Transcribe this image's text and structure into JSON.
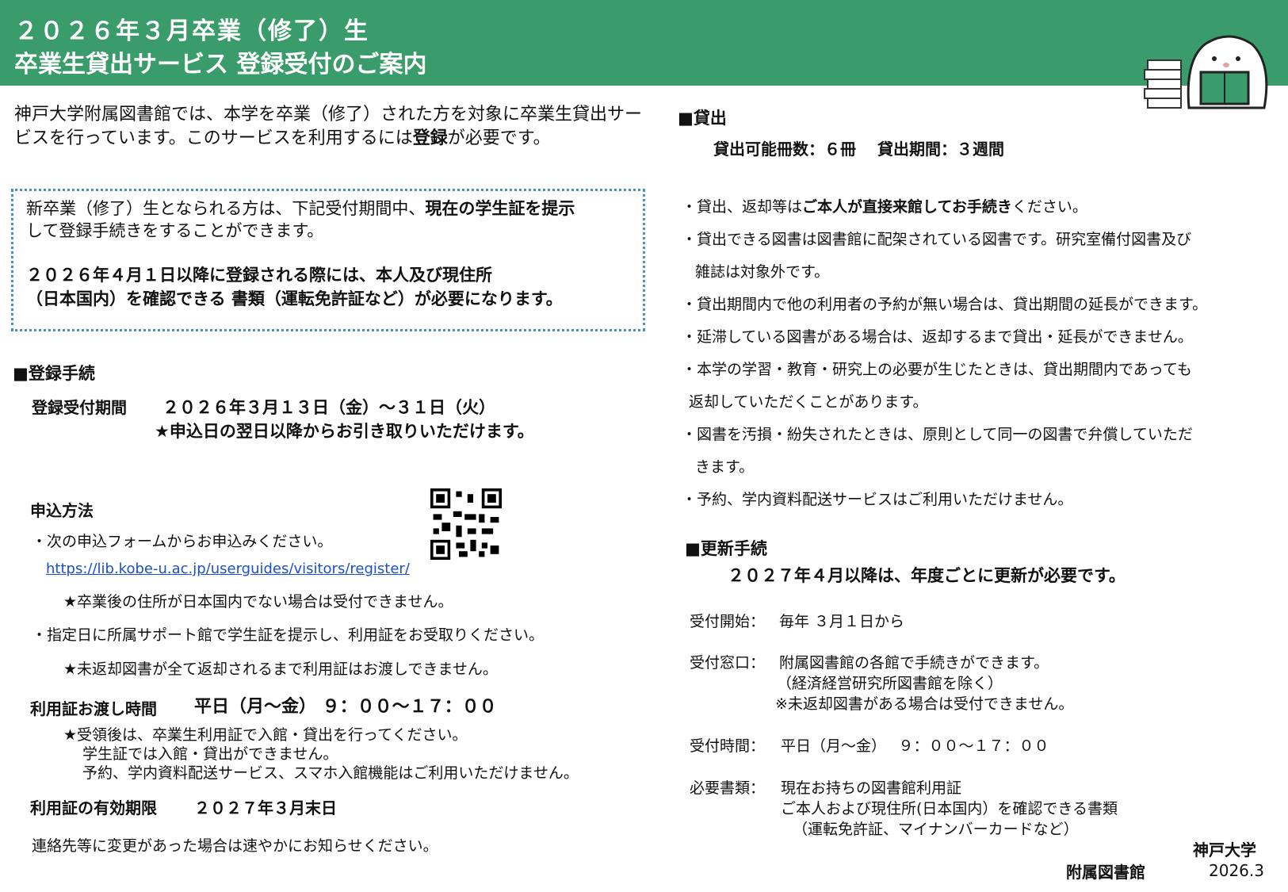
{
  "header": {
    "line1": "２０２６年３月卒業（修了）生",
    "line2": "卒業生貸出サービス 登録受付のご案内"
  },
  "intro": {
    "before": "神戸大学附属図書館では、本学を卒業（修了）された方を対象に卒業生貸出サービスを行っています。このサービスを利用するには",
    "bold": "登録",
    "after": "が必要です。"
  },
  "notice": {
    "l1_before": "新卒業（修了）生となられる方は、下記受付期間中、",
    "l1_bold": "現在の学生証を提示",
    "l2": "して登録手続きをすることができます。",
    "l3": "２０２６年４月１日以降に登録される際には、本人及び現住所",
    "l4": "（日本国内）を確認できる 書類（運転免許証など）が必要になります。"
  },
  "registration": {
    "heading": "■登録手続",
    "period_label": "登録受付期間",
    "period_value": "２０２６年３月１３日（金）～３１日（火）",
    "period_note": "★申込日の翌日以降からお引き取りいただけます。",
    "method_heading": "申込方法",
    "method_1": "・次の申込フォームからお申込みください。",
    "url": "https://lib.kobe-u.ac.jp/userguides/visitors/register/",
    "method_note1": "★卒業後の住所が日本国内でない場合は受付できません。",
    "method_2": "・指定日に所属サポート館で学生証を提示し、利用証をお受取りください。",
    "method_note2": "★未返却図書が全て返却されるまで利用証はお渡しできません。",
    "handover_label": "利用証お渡し時間",
    "handover_value": "平日（月～金） ９：００～１７：００",
    "handover_n1": "★受領後は、卒業生利用証で入館・貸出を行ってください。",
    "handover_n2": "学生証では入館・貸出ができません。",
    "handover_n3": "予約、学内資料配送サービス、スマホ入館機能はご利用いただけません。",
    "validity_label": "利用証の有効期限",
    "validity_value": "２０２７年３月末日",
    "contact": "連絡先等に変更があった場合は速やかにお知らせください。"
  },
  "lending": {
    "heading": "■貸出",
    "limits": "貸出可能冊数：６冊　 貸出期間：３週間",
    "b1_before": "・貸出、返却等は",
    "b1_bold": "ご本人が直接来館してお手続き",
    "b1_after": "ください。",
    "b2a": "・貸出できる図書は図書館に配架されている図書です。研究室備付図書及び",
    "b2b": "雑誌は対象外です。",
    "b3": "・貸出期間内で他の利用者の予約が無い場合は、貸出期間の延長ができます。",
    "b4": "・延滞している図書がある場合は、返却するまで貸出・延長ができません。",
    "b5a": "・本学の学習・教育・研究上の必要が生じたときは、貸出期間内であっても",
    "b5b": "返却していただくことがあります。",
    "b6a": "・図書を汚損・紛失されたときは、原則として同一の図書で弁償していただ",
    "b6b": "きます。",
    "b7": "・予約、学内資料配送サービスはご利用いただけません。"
  },
  "renewal": {
    "heading": "■更新手続",
    "note": "２０２７年４月以降は、年度ごとに更新が必要です。",
    "start_label": "受付開始：",
    "start_value": "毎年 ３月１日から",
    "window_label": "受付窓口：",
    "window_v1": "附属図書館の各館で手続きができます。",
    "window_v2": "（経済経営研究所図書館を除く）",
    "window_v3": "※未返却図書がある場合は受付できません。",
    "time_label": "受付時間：",
    "time_value": "平日（月～金）　 ９：００～１７：００",
    "docs_label": "必要書類：",
    "docs_v1": "現在お持ちの図書館利用証",
    "docs_v2": "ご本人および現住所(日本国内）を確認できる書類",
    "docs_v3": "（運転免許証、マイナンバーカードなど）"
  },
  "footer": {
    "university": "神戸大学",
    "library": "附属図書館",
    "date": "2026.3"
  },
  "colors": {
    "header_bg": "#3a9c6a",
    "box_border": "#4a90c8",
    "link": "#1a4fd0"
  }
}
